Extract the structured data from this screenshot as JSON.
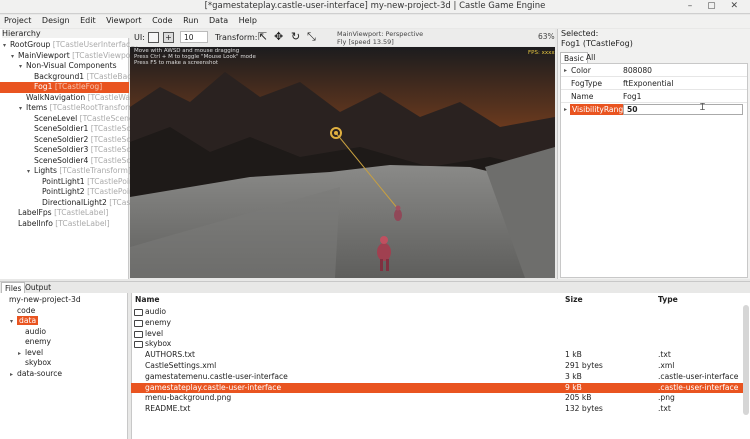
{
  "window": {
    "title": "[*gamestateplay.castle-user-interface] my-new-project-3d | Castle Game Engine",
    "controls": "– ▢ ✕"
  },
  "menu": [
    "Project",
    "Design",
    "Edit",
    "Viewport",
    "Code",
    "Run",
    "Data",
    "Help"
  ],
  "hierarchy": {
    "title": "Hierarchy",
    "items": [
      {
        "name": "RootGroup",
        "cls": "[TCastleUserInterface]",
        "level": 0,
        "toggle": "▾"
      },
      {
        "name": "MainViewport",
        "cls": "[TCastleViewport]",
        "level": 1,
        "toggle": "▾"
      },
      {
        "name": "Non-Visual Components",
        "cls": "",
        "level": 2,
        "toggle": "▾"
      },
      {
        "name": "Background1",
        "cls": "[TCastleBackground]",
        "level": 3,
        "toggle": ""
      },
      {
        "name": "Fog1",
        "cls": "[TCastleFog]",
        "level": 3,
        "toggle": "",
        "selected": true
      },
      {
        "name": "WalkNavigation",
        "cls": "[TCastleWalkNavigation]",
        "level": 2,
        "toggle": ""
      },
      {
        "name": "Items",
        "cls": "[TCastleRootTransform]",
        "level": 2,
        "toggle": "▾"
      },
      {
        "name": "SceneLevel",
        "cls": "[TCastleScene]",
        "level": 3,
        "toggle": ""
      },
      {
        "name": "SceneSoldier1",
        "cls": "[TCastleScene]",
        "level": 3,
        "toggle": ""
      },
      {
        "name": "SceneSoldier2",
        "cls": "[TCastleScene]",
        "level": 3,
        "toggle": ""
      },
      {
        "name": "SceneSoldier3",
        "cls": "[TCastleScene]",
        "level": 3,
        "toggle": ""
      },
      {
        "name": "SceneSoldier4",
        "cls": "[TCastleScene]",
        "level": 3,
        "toggle": ""
      },
      {
        "name": "Lights",
        "cls": "[TCastleTransform]",
        "level": 3,
        "toggle": "▾"
      },
      {
        "name": "PointLight1",
        "cls": "[TCastlePointLight]",
        "level": 4,
        "toggle": ""
      },
      {
        "name": "PointLight2",
        "cls": "[TCastlePointLight]",
        "level": 4,
        "toggle": ""
      },
      {
        "name": "DirectionalLight2",
        "cls": "[TCastleDirectionalLight]",
        "level": 4,
        "toggle": ""
      },
      {
        "name": "LabelFps",
        "cls": "[TCastleLabel]",
        "level": 1,
        "toggle": ""
      },
      {
        "name": "LabelInfo",
        "cls": "[TCastleLabel]",
        "level": 1,
        "toggle": ""
      }
    ]
  },
  "toolbar": {
    "ui_label": "UI:",
    "spin_value": "10",
    "transform_label": "Transform:",
    "zoom": "63%"
  },
  "viewport": {
    "info_line1": "MainViewport: Perspective",
    "info_line2": "Fly [speed 13.59]",
    "hint_line1": "Move with AWSD and mouse dragging",
    "hint_line2": "Press Ctrl + M to toggle \"Mouse Look\" mode",
    "hint_line3": "Press F5 to make a screenshot",
    "fps": "FPS: xxxx"
  },
  "inspector": {
    "selected_label": "Selected:",
    "selected_name": "Fog1 (TCastleFog)",
    "tabs": [
      "Basic",
      "All"
    ],
    "properties": [
      {
        "name": "Color",
        "value": "808080",
        "arrow": "▸"
      },
      {
        "name": "FogType",
        "value": "ftExponential",
        "arrow": ""
      },
      {
        "name": "Name",
        "value": "Fog1",
        "arrow": ""
      },
      {
        "name": "VisibilityRange",
        "value": "50",
        "arrow": "▸",
        "editing": true
      }
    ]
  },
  "bottom_tabs": [
    "Files",
    "Output"
  ],
  "files_tree": [
    {
      "name": "my-new-project-3d",
      "level": 0,
      "toggle": ""
    },
    {
      "name": "code",
      "level": 1,
      "toggle": ""
    },
    {
      "name": "data",
      "level": 1,
      "toggle": "▾",
      "selected": true
    },
    {
      "name": "audio",
      "level": 2,
      "toggle": ""
    },
    {
      "name": "enemy",
      "level": 2,
      "toggle": ""
    },
    {
      "name": "level",
      "level": 2,
      "toggle": "▸"
    },
    {
      "name": "skybox",
      "level": 2,
      "toggle": ""
    },
    {
      "name": "data-source",
      "level": 1,
      "toggle": "▸"
    }
  ],
  "file_list": {
    "headers": {
      "name": "Name",
      "size": "Size",
      "type": "Type"
    },
    "rows": [
      {
        "name": "audio",
        "size": "",
        "type": "",
        "folder": true
      },
      {
        "name": "enemy",
        "size": "",
        "type": "",
        "folder": true
      },
      {
        "name": "level",
        "size": "",
        "type": "",
        "folder": true
      },
      {
        "name": "skybox",
        "size": "",
        "type": "",
        "folder": true
      },
      {
        "name": "AUTHORS.txt",
        "size": "1 kB",
        "type": ".txt"
      },
      {
        "name": "CastleSettings.xml",
        "size": "291 bytes",
        "type": ".xml"
      },
      {
        "name": "gamestatemenu.castle-user-interface",
        "size": "3 kB",
        "type": ".castle-user-interface"
      },
      {
        "name": "gamestateplay.castle-user-interface",
        "size": "9 kB",
        "type": ".castle-user-interface",
        "selected": true
      },
      {
        "name": "menu-background.png",
        "size": "205 kB",
        "type": ".png"
      },
      {
        "name": "README.txt",
        "size": "132 bytes",
        "type": ".txt"
      }
    ]
  },
  "colors": {
    "accent": "#e95420",
    "panel": "#f1f1f0",
    "viewport_sky": "#a05a2c"
  }
}
